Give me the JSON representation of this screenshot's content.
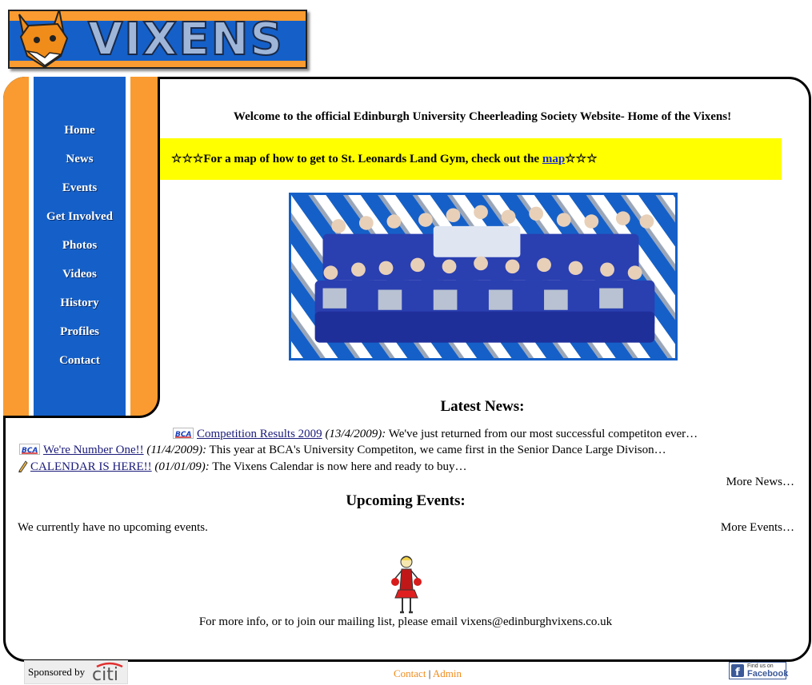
{
  "header": {
    "logo_text": "VIXENS"
  },
  "nav": {
    "items": [
      "Home",
      "News",
      "Events",
      "Get Involved",
      "Photos",
      "Videos",
      "History",
      "Profiles",
      "Contact"
    ]
  },
  "main": {
    "welcome": "Welcome to the official Edinburgh University Cheerleading Society Website- Home of the Vixens!",
    "map_prefix": "☆☆☆For a map of how to get to St. Leonards Land Gym, check out the ",
    "map_link": "map",
    "map_suffix": "☆☆☆",
    "news_title": "Latest News:",
    "news": [
      {
        "badge": "BCA",
        "title": "Competition Results 2009",
        "date": "(13/4/2009):",
        "text": " We've just returned from our most successful competiton ever…"
      },
      {
        "badge": "BCA",
        "title": "We're Number One!!",
        "date": "(11/4/2009):",
        "text": " This year at BCA's University Competiton, we came first in the Senior Dance Large Divison…"
      },
      {
        "badge": "pencil",
        "title": "CALENDAR IS HERE!!",
        "date": "(01/01/09):",
        "text": " The Vixens Calendar is now here and ready to buy…"
      }
    ],
    "more_news": "More News…",
    "events_title": "Upcoming Events:",
    "no_events": "We currently have no upcoming events.",
    "more_events": "More Events…",
    "footer_msg": "For more info, or to join our mailing list, please email vixens@edinburghvixens.co.uk"
  },
  "bottom": {
    "sponsored_by": "Sponsored by",
    "sponsor_name": "citi",
    "contact": "Contact",
    "separator": "|",
    "admin": "Admin",
    "facebook_small": "Find us on",
    "facebook": "Facebook"
  },
  "colors": {
    "orange": "#f99b30",
    "blue": "#1560c8",
    "yellow": "#ffff00"
  }
}
